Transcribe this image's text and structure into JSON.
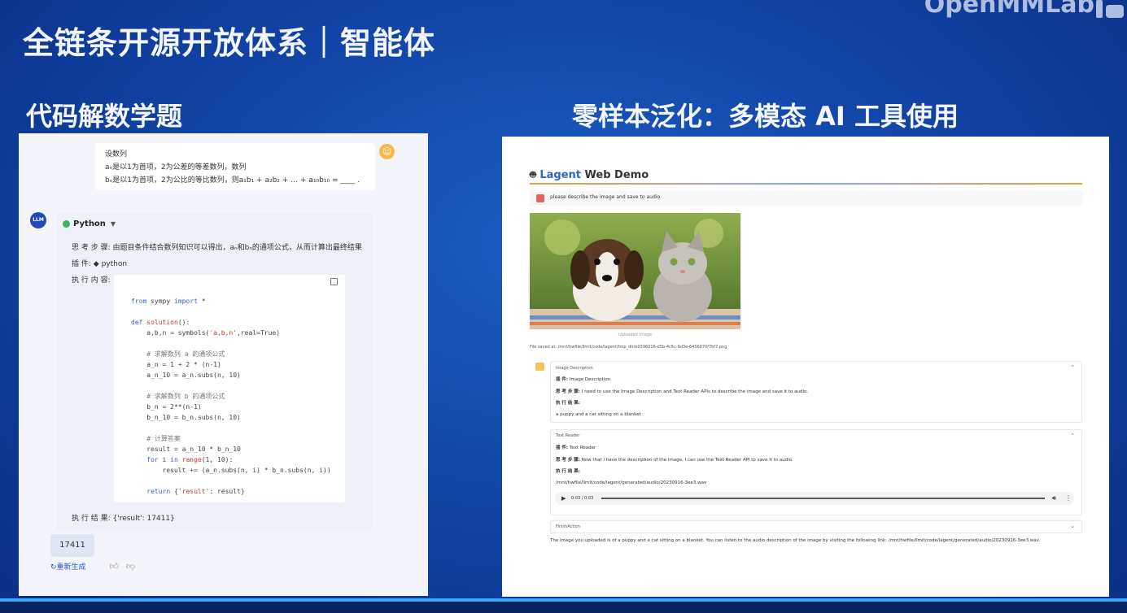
{
  "slide": {
    "title": "全链条开源开放体系｜智能体",
    "brand": "OpenMMLab"
  },
  "left": {
    "section_title": "代码解数学题",
    "question": {
      "line1": "设数列",
      "line2": "aₙ是以1为首项，2为公差的等差数列，数列",
      "line3": "bₙ是以1为首项，2为公比的等比数列，则a₁b₁ + a₂b₂ + … + a₁₀b₁₀ = ____ ."
    },
    "llm_label": "LLM",
    "tool_header": "Python",
    "thought_label": "思 考 步 骤:",
    "thought_text": "由题目条件结合数列知识可以得出，aₙ和bₙ的通项公式，从而计算出最终结果",
    "plugin_label": "插         件:",
    "plugin_value": "python",
    "exec_label": "执 行 内 容:",
    "result_label": "执 行 结 果:",
    "result_value": "{'result': 17411}",
    "answer": "17411",
    "regenerate": "重新生成"
  },
  "right": {
    "section_title": "零样本泛化：多模态 AI 工具使用",
    "demo_brand": "Lagent",
    "demo_title_rest": " Web Demo",
    "prompt": "please describe the image and save to audio",
    "image_caption": "Uploaded Image",
    "saved_text": "File saved at: /mnt/hwfile/llmit/code/lagent/tmp_dir/e0396016-d5b-4c6c-9d3e-6456070f7bf7.png",
    "acc1": {
      "title": "Image Description",
      "plugin_label": "插         件:",
      "plugin_value": "Image Description",
      "thought_label": "思 考 步 骤:",
      "thought_value": "I need to use the Image Description and Text Reader APIs to describe the image and save it to audio.",
      "result_label": "执 行 结 果:",
      "result_value": "a puppy and a cat sitting on a blanket"
    },
    "acc2": {
      "title": "Text Reader",
      "plugin_label": "插         件:",
      "plugin_value": "Text Reader",
      "thought_label": "思 考 步 骤:",
      "thought_value": "Now that I have the description of the image, I can use the Text Reader API to save it to audio.",
      "result_label": "执 行 结 果:",
      "result_value": "/mnt/hwfile/llmit/code/lagent/generated/audio/20230916-3ee3.wav",
      "audio_time": "0:03 / 0:03"
    },
    "acc3": {
      "title": "FinishAction"
    },
    "final_text": "The image you uploaded is of a puppy and a cat sitting on a blanket. You can listen to the audio description of the image by visiting the following link: /mnt/hwfile/llmit/code/lagent/generated/audio/20230916-3ee3.wav."
  }
}
